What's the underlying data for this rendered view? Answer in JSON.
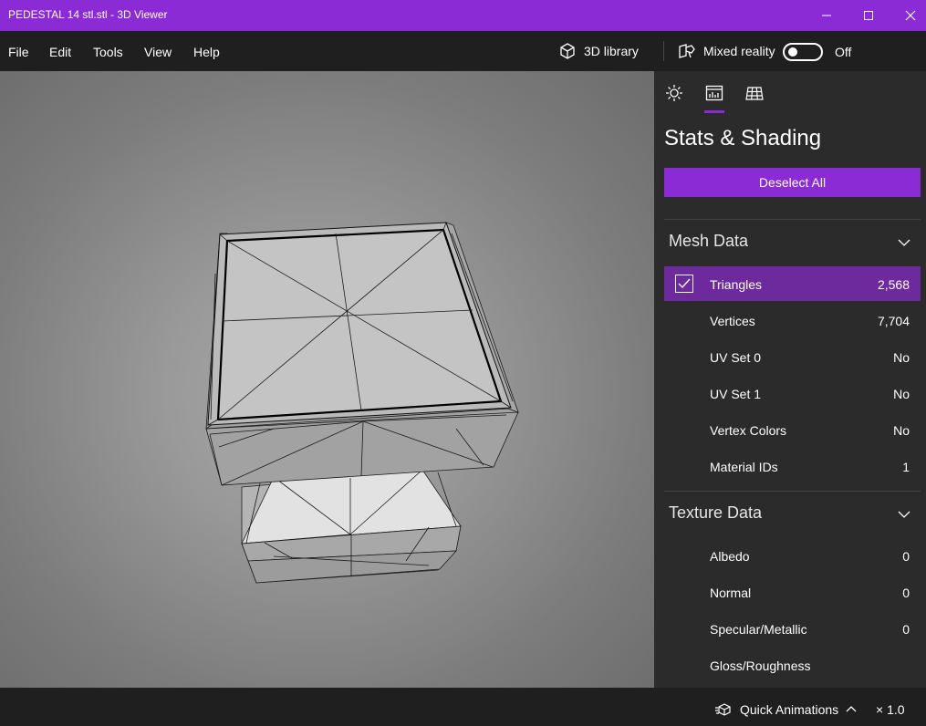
{
  "window": {
    "title": "PEDESTAL 14 stl.stl - 3D Viewer",
    "accent_color": "#8b2bd6"
  },
  "menu": {
    "items": [
      "File",
      "Edit",
      "Tools",
      "View",
      "Help"
    ]
  },
  "toolbar": {
    "library_label": "3D library",
    "mixed_reality_label": "Mixed reality",
    "mixed_reality_state": "Off"
  },
  "panel": {
    "tabs": [
      {
        "icon": "lighting-icon"
      },
      {
        "icon": "stats-icon",
        "active": true
      },
      {
        "icon": "grid-icon"
      }
    ],
    "title": "Stats & Shading",
    "deselect_label": "Deselect All",
    "mesh_section": {
      "title": "Mesh Data",
      "rows": [
        {
          "label": "Triangles",
          "value": "2,568",
          "checked": true
        },
        {
          "label": "Vertices",
          "value": "7,704"
        },
        {
          "label": "UV Set 0",
          "value": "No"
        },
        {
          "label": "UV Set 1",
          "value": "No"
        },
        {
          "label": "Vertex Colors",
          "value": "No"
        },
        {
          "label": "Material IDs",
          "value": "1"
        }
      ]
    },
    "texture_section": {
      "title": "Texture Data",
      "rows": [
        {
          "label": "Albedo",
          "value": "0"
        },
        {
          "label": "Normal",
          "value": "0"
        },
        {
          "label": "Specular/Metallic",
          "value": "0"
        },
        {
          "label": "Gloss/Roughness",
          "value": ""
        }
      ]
    }
  },
  "bottom": {
    "quick_animations_label": "Quick Animations",
    "speed_label": "× 1.0"
  }
}
